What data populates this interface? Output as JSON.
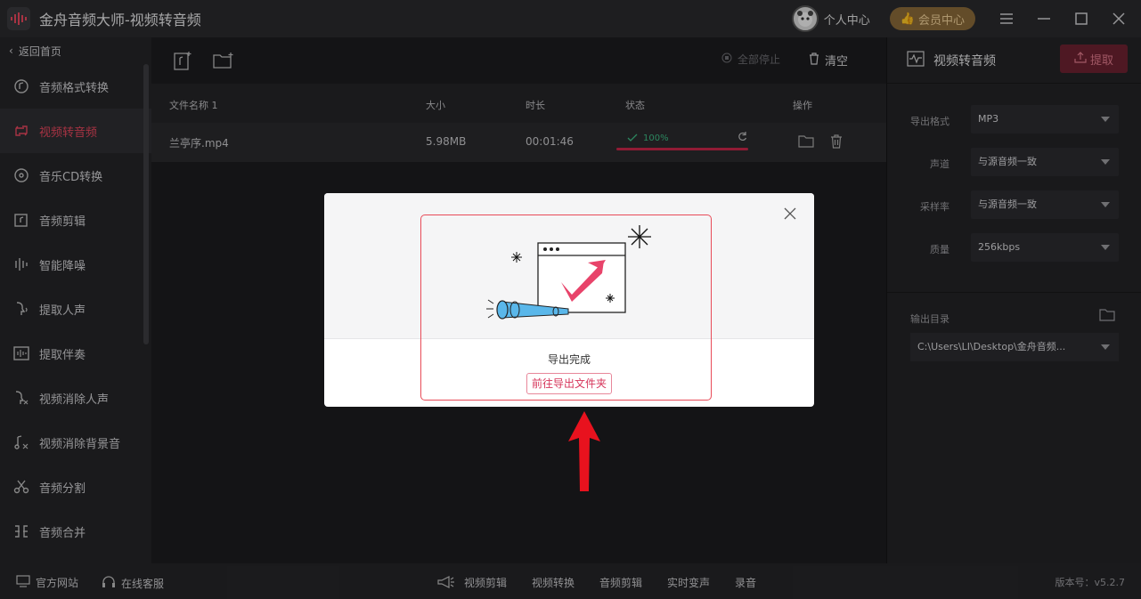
{
  "titlebar": {
    "app_title": "金舟音频大师-视频转音频",
    "personal_center": "个人中心",
    "vip_center": "会员中心"
  },
  "sidebar": {
    "back": "返回首页",
    "items": [
      {
        "label": "音频格式转换",
        "icon": "audio-convert-icon"
      },
      {
        "label": "视频转音频",
        "icon": "video-to-audio-icon",
        "active": true
      },
      {
        "label": "音乐CD转换",
        "icon": "cd-icon"
      },
      {
        "label": "音频剪辑",
        "icon": "audio-cut-icon"
      },
      {
        "label": "智能降噪",
        "icon": "denoise-icon"
      },
      {
        "label": "提取人声",
        "icon": "voice-extract-icon"
      },
      {
        "label": "提取伴奏",
        "icon": "accompaniment-icon"
      },
      {
        "label": "视频消除人声",
        "icon": "remove-voice-icon"
      },
      {
        "label": "视频消除背景音",
        "icon": "remove-bg-icon"
      },
      {
        "label": "音频分割",
        "icon": "scissors-icon"
      },
      {
        "label": "音频合并",
        "icon": "merge-icon"
      }
    ]
  },
  "toolbar": {
    "stop_all": "全部停止",
    "clear": "清空"
  },
  "table": {
    "headers": {
      "name": "文件名称 1",
      "size": "大小",
      "duration": "时长",
      "status": "状态",
      "actions": "操作"
    },
    "rows": [
      {
        "name": "兰亭序.mp4",
        "size": "5.98MB",
        "duration": "00:01:46",
        "progress_text": "100%",
        "progress": 1.0
      }
    ]
  },
  "right_panel": {
    "title": "视频转音频",
    "extract": "提取",
    "fields": [
      {
        "label": "导出格式",
        "value": "MP3"
      },
      {
        "label": "声道",
        "value": "与源音频一致"
      },
      {
        "label": "采样率",
        "value": "与源音频一致"
      },
      {
        "label": "质量",
        "value": "256kbps"
      }
    ],
    "output_dir_label": "输出目录",
    "output_dir_value": "C:\\Users\\LI\\Desktop\\金舟音频..."
  },
  "bottombar": {
    "website": "官方网站",
    "service": "在线客服",
    "links": [
      "视频剪辑",
      "视频转换",
      "音频剪辑",
      "实时变声",
      "录音"
    ],
    "version": "版本号：v5.2.7"
  },
  "dialog": {
    "message": "导出完成",
    "open_folder": "前往导出文件夹"
  },
  "colors": {
    "accent": "#e8475e",
    "progress": "#c9264a",
    "success": "#3dbb84",
    "vip": "#8a6a3a"
  }
}
